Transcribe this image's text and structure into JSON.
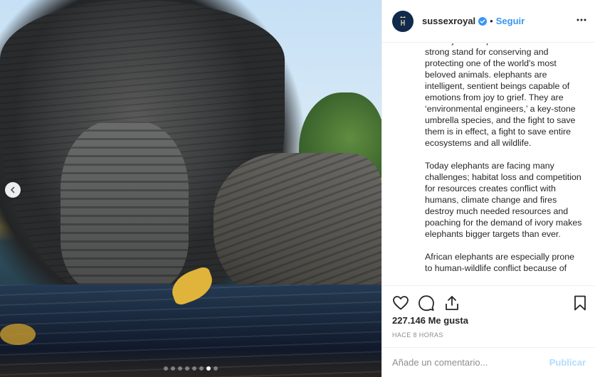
{
  "post": {
    "username": "sussexroyal",
    "separator": "•",
    "follow_label": "Seguir",
    "verified_icon": "verified-badge-icon",
    "more_icon": "more-options-icon"
  },
  "caption": {
    "paragraphs": [
      "the majestic elephant and to make a strong stand for conserving and protecting one of the world's most beloved animals. elephants are intelligent, sentient beings capable of emotions from joy to grief. They are ‘environmental engineers,’ a key-stone umbrella species, and the fight to save them is in effect, a fight to save entire ecosystems and all wildlife.",
      "Today elephants are facing many challenges; habitat loss and competition for resources creates conflict with humans, climate change and fires destroy much needed resources and poaching for the demand of ivory makes elephants bigger targets than ever.",
      "African elephants are especially prone to human-wildlife conflict because of"
    ]
  },
  "actions": {
    "like_icon": "heart-icon",
    "comment_icon": "comment-icon",
    "share_icon": "share-icon",
    "save_icon": "bookmark-icon"
  },
  "likes_text": "227.146 Me gusta",
  "timestamp": "HACE 8 HORAS",
  "comment": {
    "placeholder": "Añade un comentario...",
    "publish_label": "Publicar"
  },
  "carousel": {
    "prev_icon": "chevron-left-icon",
    "slide_count": 8,
    "active_index": 6
  },
  "colors": {
    "accent": "#3897f0",
    "publish_disabled": "#b3dbff",
    "avatar_bg": "#102a4c"
  }
}
